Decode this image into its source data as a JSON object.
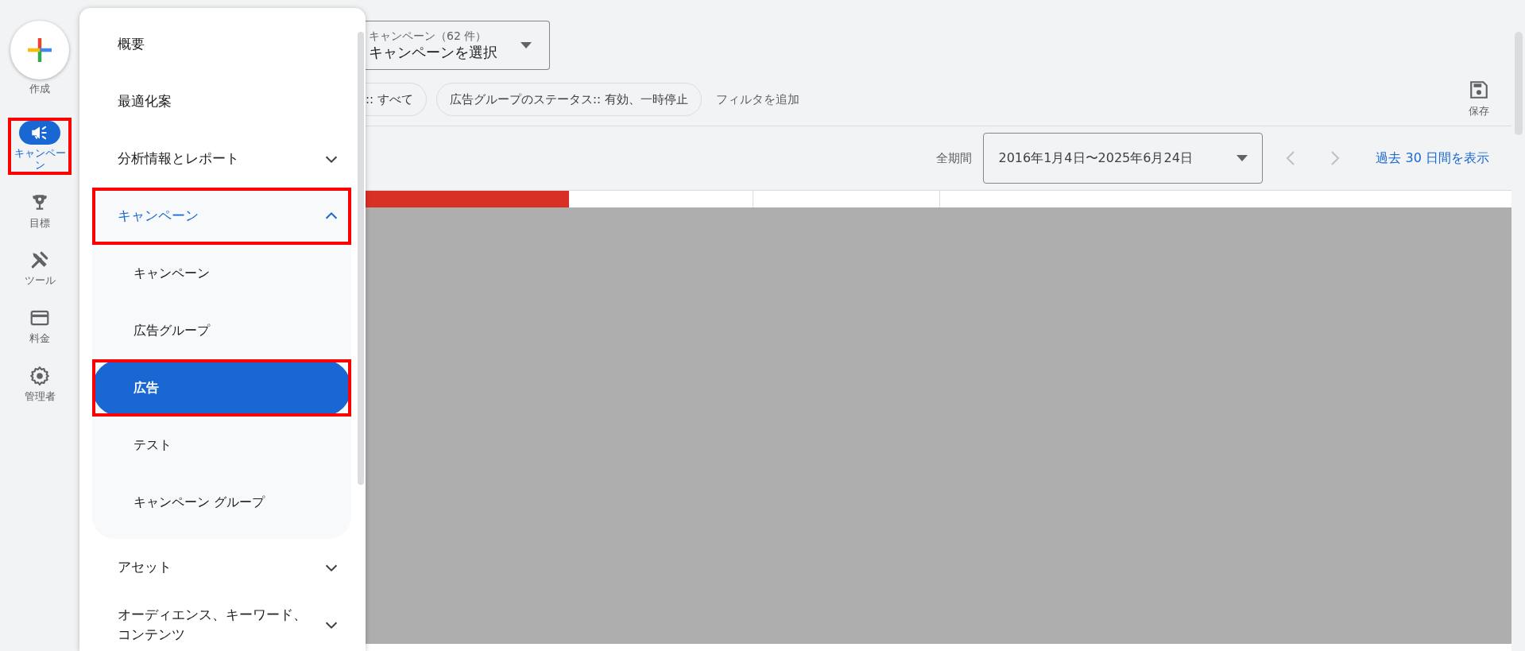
{
  "rail": {
    "create": {
      "label": "作成"
    },
    "items": [
      {
        "label": "キャンペーン",
        "selected": true,
        "highlighted": true
      },
      {
        "label": "目標",
        "selected": false,
        "highlighted": false
      },
      {
        "label": "ツール",
        "selected": false,
        "highlighted": false
      },
      {
        "label": "料金",
        "selected": false,
        "highlighted": false
      },
      {
        "label": "管理者",
        "selected": false,
        "highlighted": false
      }
    ]
  },
  "menu": {
    "items": [
      {
        "kind": "link",
        "label": "概要",
        "selected": false,
        "highlighted": false
      },
      {
        "kind": "link",
        "label": "最適化案",
        "selected": false,
        "highlighted": false
      },
      {
        "kind": "group",
        "label": "分析情報とレポート",
        "expanded": false,
        "selected": false,
        "highlighted": false
      },
      {
        "kind": "group",
        "label": "キャンペーン",
        "expanded": true,
        "selected": true,
        "highlighted": true,
        "children": [
          {
            "label": "キャンペーン",
            "selected": false,
            "highlighted": false
          },
          {
            "label": "広告グループ",
            "selected": false,
            "highlighted": false
          },
          {
            "label": "広告",
            "selected": true,
            "highlighted": true
          },
          {
            "label": "テスト",
            "selected": false,
            "highlighted": false
          },
          {
            "label": "キャンペーン グループ",
            "selected": false,
            "highlighted": false
          }
        ]
      },
      {
        "kind": "group",
        "label": "アセット",
        "expanded": false,
        "selected": false,
        "highlighted": false
      },
      {
        "kind": "group",
        "label": "オーディエンス、キーワード、コンテンツ",
        "expanded": false,
        "selected": false,
        "highlighted": false
      }
    ]
  },
  "campaign_picker": {
    "label": "キャンペーン（62 件）",
    "value": "キャンペーンを選択"
  },
  "filters": [
    {
      "label": ":: すべて"
    },
    {
      "label": "広告グループのステータス:: 有効、一時停止"
    }
  ],
  "add_filter": "フィルタを追加",
  "save": {
    "label": "保存"
  },
  "date_range": {
    "label": "全期間",
    "value": "2016年1月4日〜2025年6月24日"
  },
  "show_last_30": "過去 30 日間を表示"
}
